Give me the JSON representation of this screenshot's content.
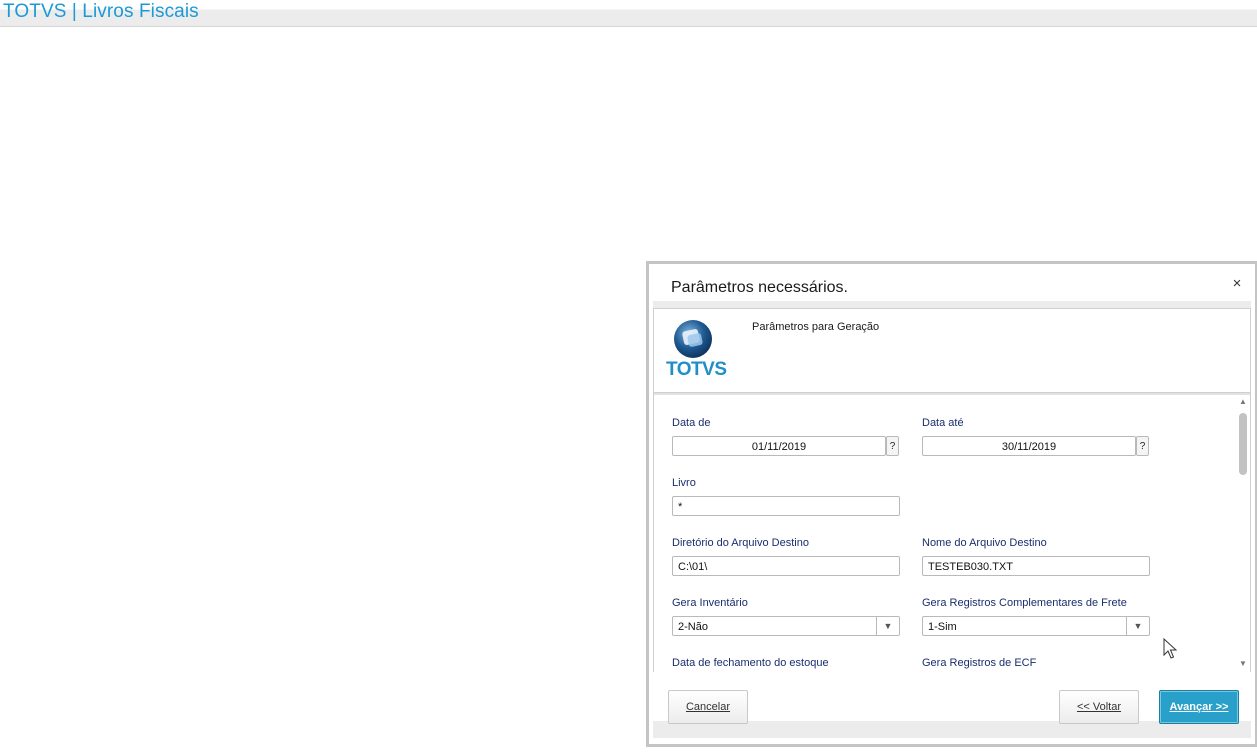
{
  "app": {
    "title": "TOTVS | Livros Fiscais"
  },
  "dialog": {
    "title": "Parâmetros necessários.",
    "close_symbol": "×",
    "banner": {
      "logo_text": "TOTVS",
      "subtitle": "Parâmetros para Geração"
    },
    "fields": {
      "data_de": {
        "label": "Data de",
        "value": "01/11/2019",
        "help": "?"
      },
      "data_ate": {
        "label": "Data até",
        "value": "30/11/2019",
        "help": "?"
      },
      "livro": {
        "label": "Livro",
        "value": "*"
      },
      "diretorio": {
        "label": "Diretório do Arquivo Destino",
        "value": "C:\\01\\"
      },
      "nome_arquivo": {
        "label": "Nome do Arquivo Destino",
        "value": "TESTEB030.TXT"
      },
      "gera_inventario": {
        "label": "Gera Inventário",
        "value": "2-Não"
      },
      "gera_frete": {
        "label": "Gera Registros Complementares de Frete",
        "value": "1-Sim"
      },
      "data_fechamento": {
        "label": "Data de fechamento do estoque"
      },
      "gera_ecf": {
        "label": "Gera Registros de ECF"
      }
    },
    "buttons": {
      "cancel": "Cancelar",
      "back": "<< Voltar",
      "next": "Avançar >>"
    }
  },
  "icons": {
    "close": "close-icon",
    "select_arrow": "chevron-down-icon",
    "scroll_up": "scroll-up-icon",
    "scroll_down": "scroll-down-icon",
    "logo": "totvs-logo-icon",
    "cursor": "mouse-pointer-icon"
  },
  "colors": {
    "header_accent": "#1c9ad6",
    "label": "#1a2e6e",
    "primary_button": "#29a0c9"
  }
}
